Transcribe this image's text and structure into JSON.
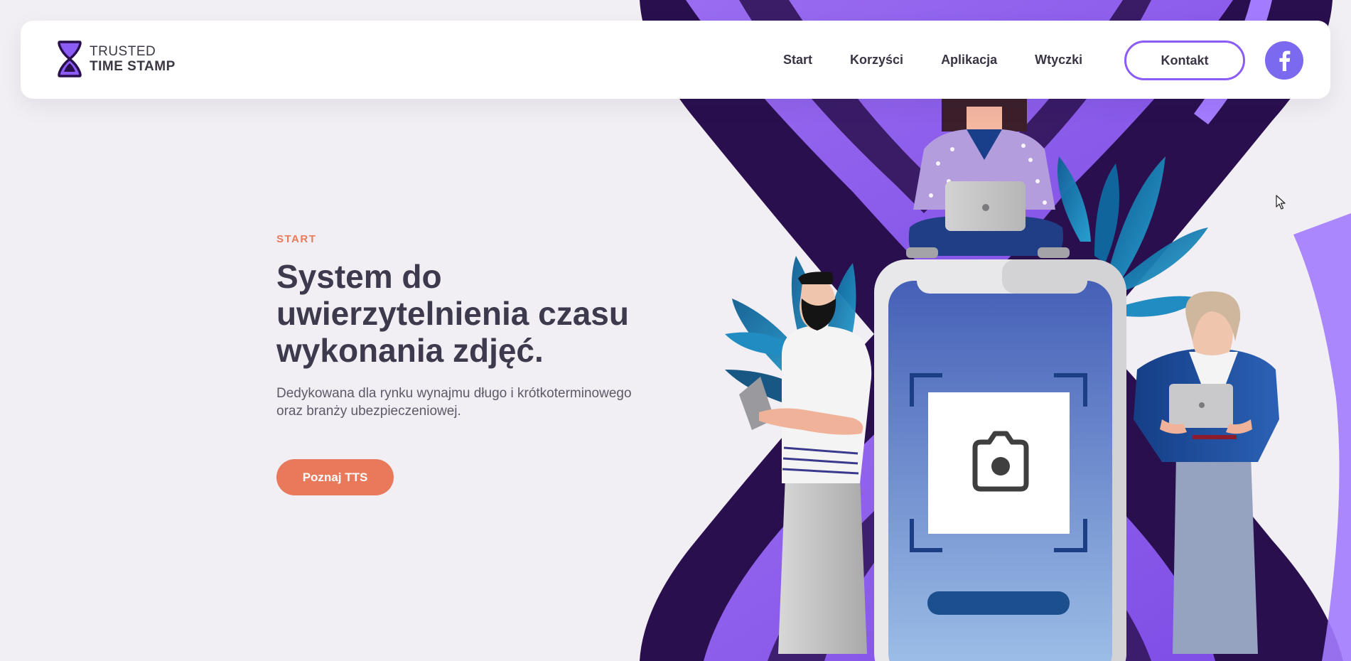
{
  "colors": {
    "page_bg": "#f1eff3",
    "accent_purple": "#8b5cf6",
    "dark_purple": "#2a0f4f",
    "cta_orange": "#e8795a",
    "facebook_bg": "#7b69ef",
    "text_dark": "#3e3a4d"
  },
  "header": {
    "logo": {
      "line1": "TRUSTED",
      "line2": "TIME STAMP",
      "icon": "hourglass-icon"
    },
    "nav": [
      {
        "label": "Start"
      },
      {
        "label": "Korzyści"
      },
      {
        "label": "Aplikacja"
      },
      {
        "label": "Wtyczki"
      }
    ],
    "contact_label": "Kontakt",
    "social_icon": "facebook-icon"
  },
  "hero": {
    "eyebrow": "START",
    "headline_lines": [
      "System do",
      "uwierzytelnienia czasu",
      "wykonania zdjęć."
    ],
    "lead_lines": [
      "Dedykowana dla rynku wynajmu długo i krótkoterminowego",
      "oraz branży ubezpieczeniowej."
    ],
    "cta_label": "Poznaj TTS"
  },
  "illustration": {
    "phone_icon": "camera-icon",
    "description_elements": [
      "phone",
      "person-sitting-with-laptop",
      "man-with-tablet",
      "woman-with-laptop",
      "plants"
    ]
  }
}
